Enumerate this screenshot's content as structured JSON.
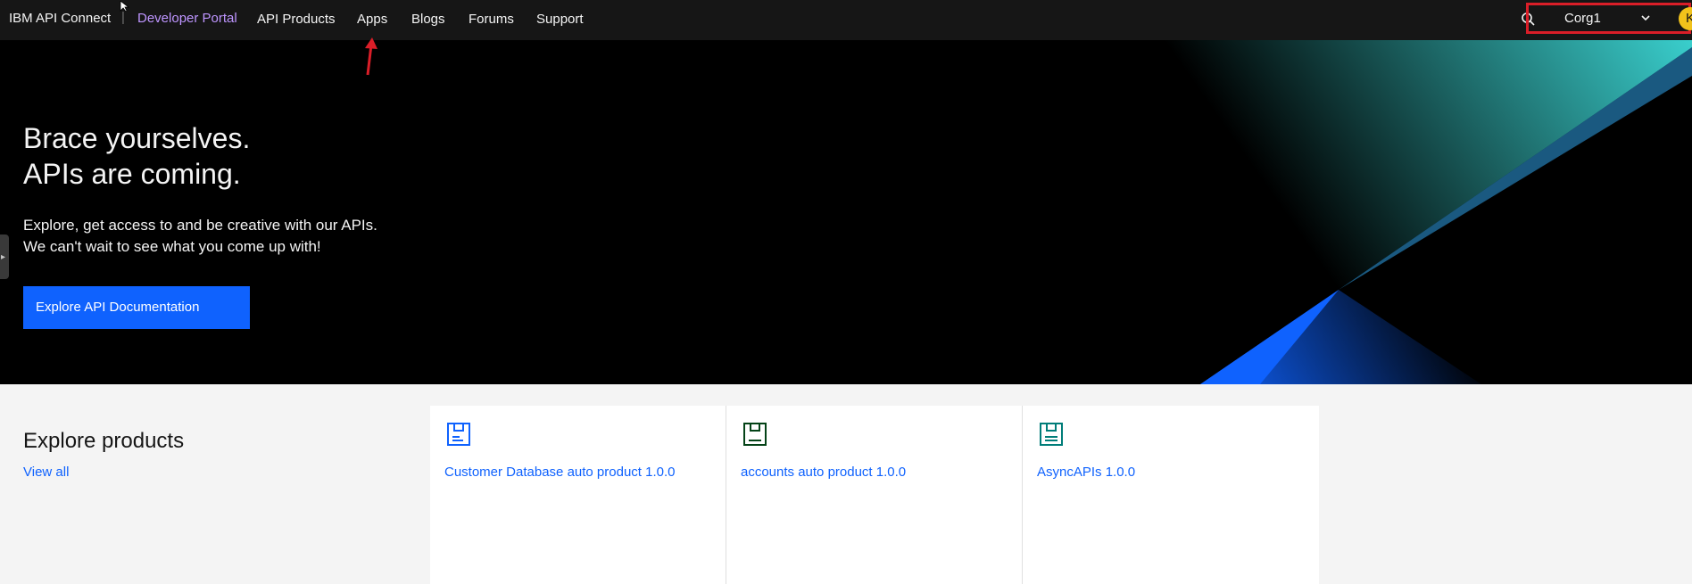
{
  "header": {
    "brand": "IBM API Connect",
    "separator": "|",
    "portal_label": "Developer Portal",
    "nav": [
      "API Products",
      "Apps",
      "Blogs",
      "Forums",
      "Support"
    ],
    "org": "Corg1",
    "avatar_initial": "K",
    "search_icon": "search-icon",
    "dropdown_icon": "chevron-down-icon"
  },
  "hero": {
    "title_line1": "Brace yourselves.",
    "title_line2": "APIs are coming.",
    "sub_line1": "Explore, get access to and be creative with our APIs.",
    "sub_line2": "We can't wait to see what you come up with!",
    "cta": "Explore API Documentation"
  },
  "products": {
    "heading": "Explore products",
    "view_all": "View all",
    "items": [
      {
        "name": "Customer Database auto product 1.0.0",
        "icon": "product-icon",
        "color": "#0f62fe"
      },
      {
        "name": "accounts auto product 1.0.0",
        "icon": "product-icon",
        "color": "#044317"
      },
      {
        "name": "AsyncAPIs 1.0.0",
        "icon": "product-icon",
        "color": "#007d79"
      }
    ]
  },
  "colors": {
    "accent": "#0f62fe",
    "portal_purple": "#be95ff",
    "highlight_red": "#da1e28",
    "avatar": "#f1c21b"
  }
}
